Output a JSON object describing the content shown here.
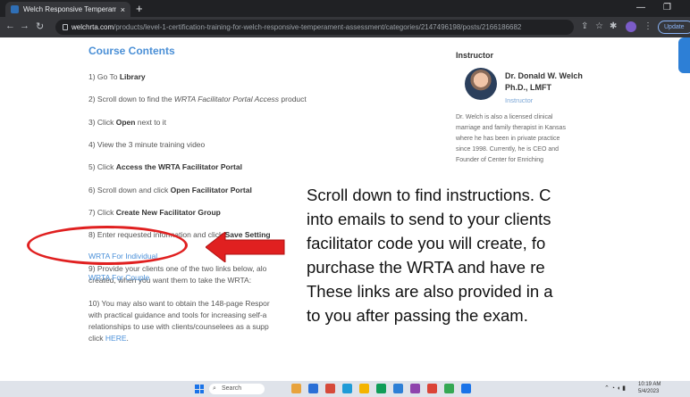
{
  "browser": {
    "tab_title": "Welch Responsive Temperament",
    "tab_close": "×",
    "new_tab": "+",
    "url_host": "welchrta.com",
    "url_path": "/products/level-1-certification-training-for-welch-responsive-temperament-assessment/categories/2147496198/posts/2166186682",
    "update_label": "Update"
  },
  "course": {
    "heading": "Course Contents",
    "steps": [
      {
        "pre": "1) Go To ",
        "bold": "Library",
        "post": ""
      },
      {
        "pre": "2) Scroll down to find the ",
        "italic": "WRTA Facilitator Portal Access",
        "post": " product"
      },
      {
        "pre": "3) Click ",
        "bold": "Open",
        "post": " next to it"
      },
      {
        "pre": "4) View the 3 minute training video",
        "bold": "",
        "post": ""
      },
      {
        "pre": "5) Click ",
        "bold": "Access the WRTA Facilitator Portal",
        "post": ""
      },
      {
        "pre": "6) Scroll down and click ",
        "bold": "Open Facilitator Portal",
        "post": ""
      },
      {
        "pre": "7) Click ",
        "bold": "Create New Facilitator Group",
        "post": ""
      },
      {
        "pre": "8) Enter requested information and click ",
        "bold": "Save Setting",
        "post": ""
      }
    ],
    "step9_line1": "9) Provide your clients one of the two links below, alo",
    "step9_line2": "created, when you want them to take the WRTA:",
    "link_individual": "WRTA For Individual",
    "link_couple": "WRTA For Couple",
    "step10_lines": [
      "10) You may also want to obtain the 148-page Respor",
      "with practical guidance and tools for increasing self-a",
      "relationships to use with clients/counselees as a supp"
    ],
    "step10_last_pre": "click ",
    "step10_link": "HERE",
    "step10_last_post": "."
  },
  "instructor": {
    "title": "Instructor",
    "name_line1": "Dr. Donald W. Welch",
    "name_line2": "Ph.D., LMFT",
    "role": "Instructor",
    "bio_lines": [
      "Dr. Welch is also a licensed clinical",
      "marriage and family therapist in Kansas",
      "where he has been in private practice",
      "since 1998. Currently, he is CEO and",
      "Founder of Center for Enriching"
    ]
  },
  "caption": {
    "lines": [
      "Scroll down to find instructions. C",
      "into emails to send to your clients",
      "facilitator code you will create, fo",
      "purchase the WRTA and have re",
      "These links are also provided in a",
      "to you after passing the exam."
    ]
  },
  "taskbar": {
    "search_label": "Search",
    "time": "10:19 AM",
    "date": "5/4/2023",
    "icon_colors": [
      "#e8a33d",
      "#2a6fd6",
      "#d64a3a",
      "#1f9bd7",
      "#f4b400",
      "#0f9d58",
      "#2d7fd6",
      "#8e44ad",
      "#db4437",
      "#34a853",
      "#1a73e8"
    ]
  },
  "colors": {
    "accent_blue": "#4a8fd6",
    "highlight_red": "#e02020"
  }
}
